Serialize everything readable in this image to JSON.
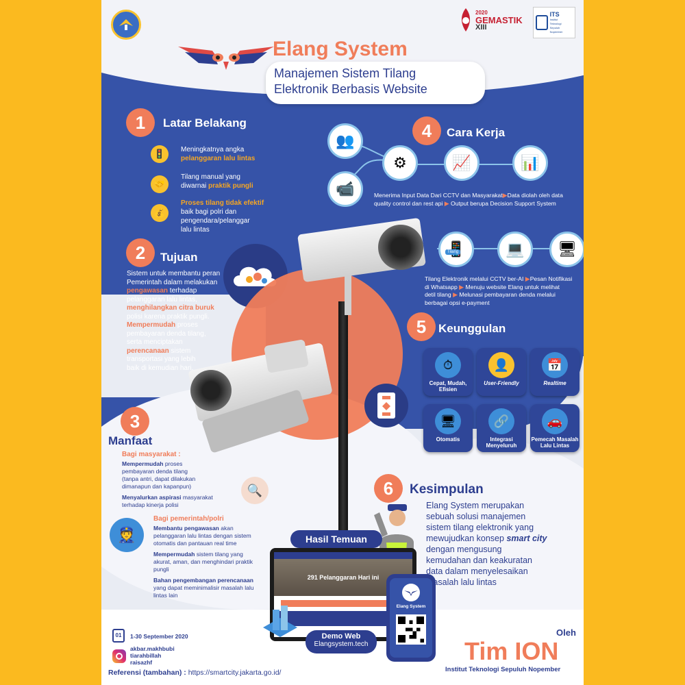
{
  "header": {
    "title": "Elang System",
    "subtitle_line1": "Manajemen Sistem Tilang",
    "subtitle_line2": "Elektronik Berbasis Website",
    "gemastik_year": "2020",
    "gemastik_name": "GEMASTIK",
    "gemastik_edition": "XIII",
    "its_logo": "ITS",
    "its_line1": "Institut",
    "its_line2": "Teknologi",
    "its_line3": "Sepuluh Nopember"
  },
  "s1": {
    "num": "1",
    "title": "Latar Belakang",
    "item1_a": "Meningkatnya angka",
    "item1_b": "pelanggaran lalu lintas",
    "item2_a": "Tilang manual yang",
    "item2_b": "diwarnai",
    "item2_c": "praktik pungli",
    "item3_a": "Proses tilang tidak efektif",
    "item3_b": "baik bagi polri dan",
    "item3_c": "pengendara/pelanggar",
    "item3_d": "lalu lintas"
  },
  "s2": {
    "num": "2",
    "title": "Tujuan",
    "l1": "Sistem untuk membantu peran",
    "l2": "Pemerintah dalam melakukan",
    "l3a": "pengawasan",
    "l3b": " terhadap",
    "l4": "pelanggaran lalu lintas,",
    "l5": "menghilangkan citra buruk",
    "l6": "polisi karena praktik pungli.",
    "l7a": "Mempermudah",
    "l7b": " proses",
    "l8": "pembayaran denda tilang,",
    "l9": "serta menciptakan",
    "l10a": "perencanaan",
    "l10b": " sistem",
    "l11": "transportasi yang lebih",
    "l12": "baik di kemudian hari."
  },
  "s3": {
    "num": "3",
    "title": "Manfaat",
    "sub1": "Bagi masyarakat :",
    "p1a": "Mempermudah",
    "p1b": " proses",
    "p1c": "pembayaran  denda tilang",
    "p1d": "(tanpa antri, dapat dilakukan",
    "p1e": "dimanapun dan kapanpun)",
    "p2a": "Menyalurkan aspirasi",
    "p2b": " masyarakat",
    "p2c": "terhadap kinerja polisi",
    "sub2": "Bagi pemerintah/polri",
    "q1a": "Membantu pengawasan",
    "q1b": " akan",
    "q1c": "pelanggaran lalu lintas dengan sistem",
    "q1d": "otomatis dan pantauan real time",
    "q2a": "Mempermudah",
    "q2b": " sistem tilang yang",
    "q2c": "akurat, aman, dan menghindari praktik",
    "q2d": "pungli",
    "q3a": "Bahan pengembangan perencanaan",
    "q3b": "yang dapat meminimalisir masalah lalu",
    "q3c": "lintas lain"
  },
  "s4": {
    "num": "4",
    "title": "Cara Kerja",
    "r1a": "Menerima Input Data Dari CCTV dan Masyarakat",
    "r1b": "Data diolah oleh data",
    "r1c": "quality control dan rest api",
    "r1d": "Output berupa Decision Support System",
    "phone_label": "Tilang",
    "r2a": "Tilang Elektronik melalui CCTV ber-AI",
    "r2b": "Pesan Notifikasi",
    "r2c": "di Whatsapp",
    "r2d": "Menuju website Elang untuk melihat",
    "r2e": "detil tilang",
    "r2f": "Melunasi pembayaran denda melalui",
    "r2g": "berbagai opsi e-payment"
  },
  "s5": {
    "num": "5",
    "title": "Keunggulan",
    "cards": [
      {
        "label1": "Cepat, Mudah,",
        "label2": "Efisien"
      },
      {
        "label1": "User-Friendly",
        "label2": ""
      },
      {
        "label1": "Realtime",
        "label2": ""
      },
      {
        "label1": "Otomatis",
        "label2": ""
      },
      {
        "label1": "Integrasi",
        "label2": "Menyeluruh"
      },
      {
        "label1": "Pemecah Masalah",
        "label2": "Lalu Lintas"
      }
    ]
  },
  "s6": {
    "num": "6",
    "title": "Kesimpulan",
    "l1": "Elang System merupakan",
    "l2": "sebuah solusi manajemen",
    "l3": "sistem tilang elektronik yang",
    "l4a": "mewujudkan konsep ",
    "l4b": "smart city",
    "l5": "dengan mengusung",
    "l6": "kemudahan dan keakuratan",
    "l7": "data dalam menyelesaikan",
    "l8": "masalah lalu lintas"
  },
  "hasil": {
    "title": "Hasil Temuan",
    "banner": "291 Pelanggaran Hari ini",
    "phone_title": "Elang System",
    "demo_title": "Demo Web",
    "demo_url": "Elangsystem.tech"
  },
  "footer": {
    "date": "1-30 September 2020",
    "calendar_day": "01",
    "ig1": "akbar.makhbubi",
    "ig2": "tiarahbillah",
    "ig3": "raisazhf",
    "ref_label": "Referensi (tambahan) :",
    "ref_url": "https://smartcity.jakarta.go.id/",
    "oleh": "Oleh",
    "team": "Tim ION",
    "institute": "Institut Teknologi Sepuluh Nopember"
  },
  "colors": {
    "background": "#FBBA1F",
    "blue": "#3653A8",
    "orange": "#F07D5A",
    "highlight": "#F5A623",
    "navy": "#2D3E8F"
  }
}
